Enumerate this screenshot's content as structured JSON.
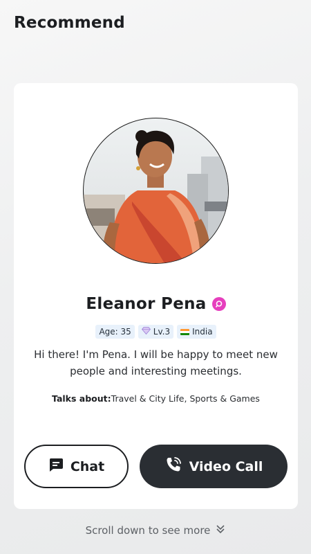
{
  "header": {
    "title": "Recommend"
  },
  "profile": {
    "name": "Eleanor Pena",
    "tags": {
      "age": "Age: 35",
      "level": "Lv.3",
      "country": "India"
    },
    "bio": "Hi there! I'm Pena. I will be happy to meet new people and interesting meetings.",
    "talks_label": "Talks about:",
    "talks_value": "Travel & City Life, Sports & Games"
  },
  "actions": {
    "chat_label": "Chat",
    "video_call_label": "Video Call"
  },
  "footer": {
    "scroll_hint": "Scroll down to see more"
  },
  "colors": {
    "badge": "#e63fbd",
    "primary_dark": "#2a2e33",
    "tag_bg": "#e8f1fb"
  },
  "icons": {
    "verified": "verified-badge-icon",
    "level": "diamond-icon",
    "country": "india-flag-icon",
    "chat": "chat-bubble-icon",
    "video": "phone-call-icon",
    "scroll": "double-chevron-down-icon"
  }
}
